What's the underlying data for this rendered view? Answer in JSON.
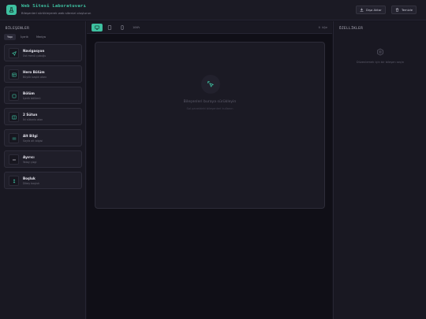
{
  "header": {
    "title": "Web Sitesi Laboratuvarı",
    "subtitle": "Bileşenleri sürükleyerek web sitenizi oluşturun",
    "export_label": "Dışa Aktar",
    "clear_label": "Temizle"
  },
  "left_panel": {
    "title": "BİLEŞENLER",
    "tabs": [
      "Yapı",
      "İçerik",
      "Medya"
    ],
    "active_tab": "Yapı",
    "components": [
      {
        "name": "Navigasyon",
        "desc": "Üst menü çubuğu",
        "icon": "navigation-icon"
      },
      {
        "name": "Hero Bölüm",
        "desc": "Büyük başlık alanı",
        "icon": "hero-icon"
      },
      {
        "name": "Bölüm",
        "desc": "İçerik bölümü",
        "icon": "section-icon"
      },
      {
        "name": "2 Sütun",
        "desc": "İki sütunlu alan",
        "icon": "two-column-icon"
      },
      {
        "name": "Alt Bilgi",
        "desc": "Sayfa alt bilgisi",
        "icon": "footer-icon"
      },
      {
        "name": "Ayırıcı",
        "desc": "Yatay çizgi",
        "icon": "divider-icon"
      },
      {
        "name": "Boşluk",
        "desc": "Dikey boşluk",
        "icon": "spacer-icon"
      }
    ]
  },
  "toolbar": {
    "zoom": "100%",
    "element_count": "0 öğe",
    "devices": [
      "desktop",
      "tablet",
      "mobile"
    ],
    "active_device": "desktop"
  },
  "canvas": {
    "empty_title": "Bileşenleri buraya sürükleyin",
    "empty_subtitle": "Sol paneldeki bileşenleri kullanın"
  },
  "right_panel": {
    "title": "ÖZELLİKLER",
    "empty_message": "Düzenlemek için bir bileşen seçin"
  },
  "colors": {
    "accent": "#3ec0a0",
    "background": "#15141d",
    "panel": "#191822"
  }
}
